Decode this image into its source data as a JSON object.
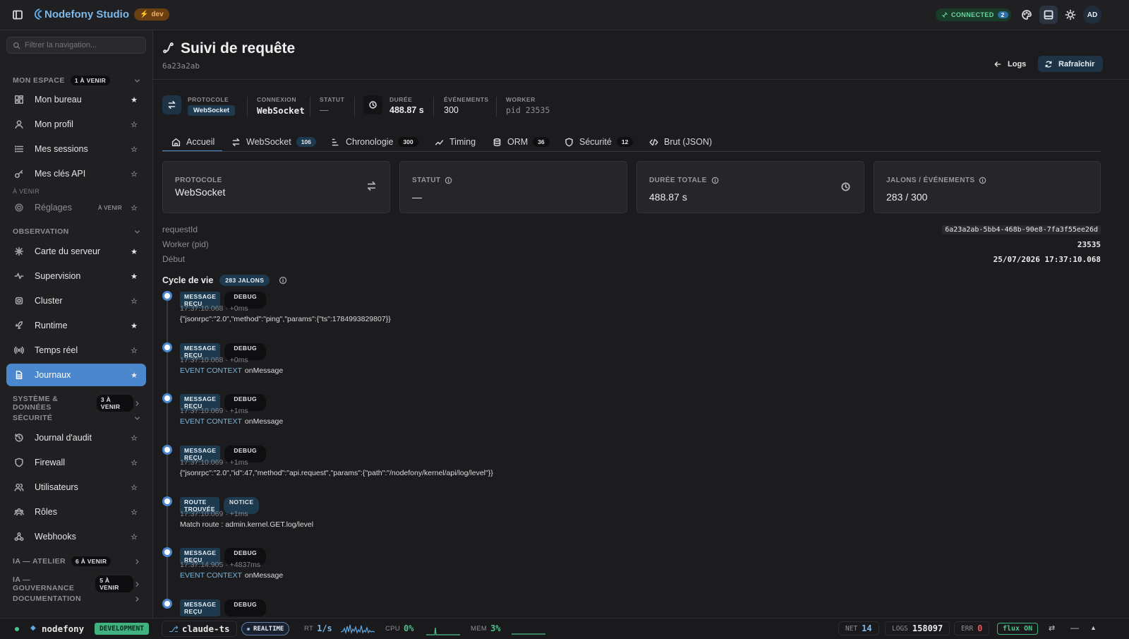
{
  "app": {
    "name": "Nodefony Studio",
    "env_badge": "dev",
    "connection": "CONNECTED",
    "connection_count": "2",
    "avatar": "AD"
  },
  "sidebar": {
    "search_placeholder": "Filtrer la navigation...",
    "sections": {
      "mon_espace": {
        "title": "MON ESPACE",
        "badge": "1 À VENIR"
      },
      "a_venir": "À VENIR",
      "observation": {
        "title": "OBSERVATION"
      },
      "systeme": {
        "title": "SYSTÈME & DONNÉES",
        "badge": "3 À VENIR"
      },
      "securite": {
        "title": "SÉCURITÉ"
      },
      "ia_atelier": {
        "title": "IA — ATELIER",
        "badge": "6 À VENIR"
      },
      "ia_gouv": {
        "title": "IA — GOUVERNANCE",
        "badge": "5 À VENIR"
      },
      "documentation": {
        "title": "DOCUMENTATION"
      }
    },
    "items": {
      "mon_bureau": "Mon bureau",
      "mon_profil": "Mon profil",
      "mes_sessions": "Mes sessions",
      "mes_cles": "Mes clés API",
      "reglages": "Réglages",
      "reglages_tag": "À VENIR",
      "carte": "Carte du serveur",
      "supervision": "Supervision",
      "cluster": "Cluster",
      "runtime": "Runtime",
      "temps_reel": "Temps réel",
      "journaux": "Journaux",
      "audit": "Journal d'audit",
      "firewall": "Firewall",
      "utilisateurs": "Utilisateurs",
      "roles": "Rôles",
      "webhooks": "Webhooks"
    }
  },
  "header": {
    "title": "Suivi de requête",
    "subtitle": "6a23a2ab",
    "logs_button": "Logs",
    "refresh_button": "Rafraîchir"
  },
  "metrics": {
    "protocole": {
      "label": "PROTOCOLE",
      "value": "WebSocket"
    },
    "connexion": {
      "label": "CONNEXION",
      "value": "WebSocket"
    },
    "statut": {
      "label": "STATUT",
      "value": "—"
    },
    "duree": {
      "label": "DURÉE",
      "value": "488.87 s"
    },
    "evenements": {
      "label": "ÉVÉNEMENTS",
      "value": "300"
    },
    "worker": {
      "label": "WORKER",
      "value": "pid 23535"
    }
  },
  "tabs": [
    {
      "label": "Accueil",
      "count": ""
    },
    {
      "label": "WebSocket",
      "count": "106"
    },
    {
      "label": "Chronologie",
      "count": "300"
    },
    {
      "label": "Timing",
      "count": ""
    },
    {
      "label": "ORM",
      "count": "36"
    },
    {
      "label": "Sécurité",
      "count": "12"
    },
    {
      "label": "Brut (JSON)",
      "count": ""
    }
  ],
  "cards": [
    {
      "label": "PROTOCOLE",
      "value": "WebSocket"
    },
    {
      "label": "STATUT",
      "value": "—"
    },
    {
      "label": "DURÉE TOTALE",
      "value": "488.87 s"
    },
    {
      "label": "JALONS / ÉVÉNEMENTS",
      "value": "283 / 300"
    }
  ],
  "details": [
    {
      "key": "requestId",
      "value": "6a23a2ab-5bb4-468b-90e8-7fa3f55ee26d"
    },
    {
      "key": "Worker (pid)",
      "value": "23535"
    },
    {
      "key": "Début",
      "value": "25/07/2026 17:37:10.068"
    }
  ],
  "lifecycle": {
    "title": "Cycle de vie",
    "badge": "283 JALONS"
  },
  "events": [
    {
      "type": "MESSAGE REÇU",
      "level": "DEBUG",
      "time": "17:37:10.068 · +0ms",
      "ctx": "",
      "msg": "{\"jsonrpc\":\"2.0\",\"method\":\"ping\",\"params\":{\"ts\":1784993829807}}"
    },
    {
      "type": "MESSAGE REÇU",
      "level": "DEBUG",
      "time": "17:37:10.068 · +0ms",
      "ctx": "EVENT CONTEXT",
      "msg": "onMessage"
    },
    {
      "type": "MESSAGE REÇU",
      "level": "DEBUG",
      "time": "17:37:10.069 · +1ms",
      "ctx": "EVENT CONTEXT",
      "msg": "onMessage"
    },
    {
      "type": "MESSAGE REÇU",
      "level": "DEBUG",
      "time": "17:37:10.069 · +1ms",
      "ctx": "",
      "msg": "{\"jsonrpc\":\"2.0\",\"id\":47,\"method\":\"api.request\",\"params\":{\"path\":\"/nodefony/kernel/api/log/level\"}}"
    },
    {
      "type": "ROUTE TROUVÉE",
      "level": "NOTICE",
      "time": "17:37:10.069 · +1ms",
      "ctx": "",
      "msg": "Match route : admin.kernel.GET.log/level"
    },
    {
      "type": "MESSAGE REÇU",
      "level": "DEBUG",
      "time": "17:37:14.905 · +4837ms",
      "ctx": "EVENT CONTEXT",
      "msg": "onMessage"
    },
    {
      "type": "MESSAGE REÇU",
      "level": "DEBUG",
      "time": "",
      "ctx": "",
      "msg": ""
    }
  ],
  "status": {
    "app": "nodefony",
    "env": "DEVELOPMENT",
    "branch": "claude-ts",
    "realtime": "REALTIME",
    "rt_label": "RT",
    "rt_value": "1/s",
    "cpu_label": "CPU",
    "cpu_value": "0%",
    "mem_label": "MEM",
    "mem_value": "3%",
    "net_label": "NET",
    "net_value": "14",
    "logs_label": "LOGS",
    "logs_value": "158097",
    "err_label": "ERR",
    "err_value": "0",
    "flux": "flux ON"
  },
  "colors": {
    "accent": "#4a87cc",
    "connected": "#4cc38a",
    "env": "#e0902a",
    "development": "#3fb27f"
  }
}
